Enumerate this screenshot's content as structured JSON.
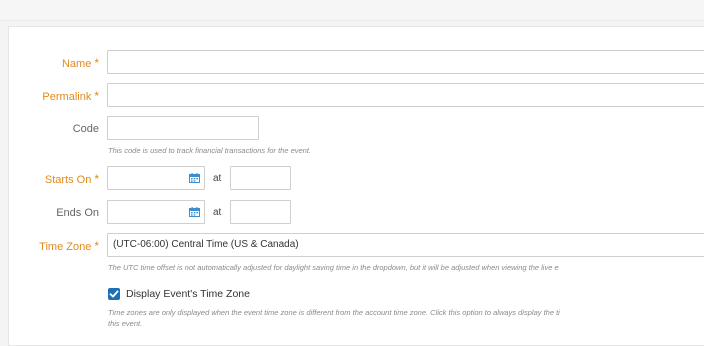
{
  "form": {
    "name": {
      "label": "Name",
      "value": ""
    },
    "permalink": {
      "label": "Permalink",
      "value": ""
    },
    "code": {
      "label": "Code",
      "value": "",
      "hint": "This code is used to track financial transactions for the event."
    },
    "starts_on": {
      "label": "Starts On",
      "date": "",
      "at_label": "at",
      "time": ""
    },
    "ends_on": {
      "label": "Ends On",
      "date": "",
      "at_label": "at",
      "time": ""
    },
    "time_zone": {
      "label": "Time Zone",
      "selected": "(UTC-06:00) Central Time (US & Canada)",
      "hint": "The UTC time offset is not automatically adjusted for daylight saving time in the dropdown, but it will be adjusted when viewing the live e"
    },
    "display_tz": {
      "label": "Display Event's Time Zone",
      "checked": true,
      "hint_line1": "Time zones are only displayed when the event time zone is different from the account time zone. Click this option to always display the ti",
      "hint_line2": "this event."
    },
    "required_marker": "*"
  },
  "colors": {
    "required": "#e08a1e",
    "checkbox": "#1f6fb4",
    "calendar": "#3b8fd0"
  },
  "icons": {
    "calendar": "calendar-icon",
    "check": "checkmark-icon"
  }
}
